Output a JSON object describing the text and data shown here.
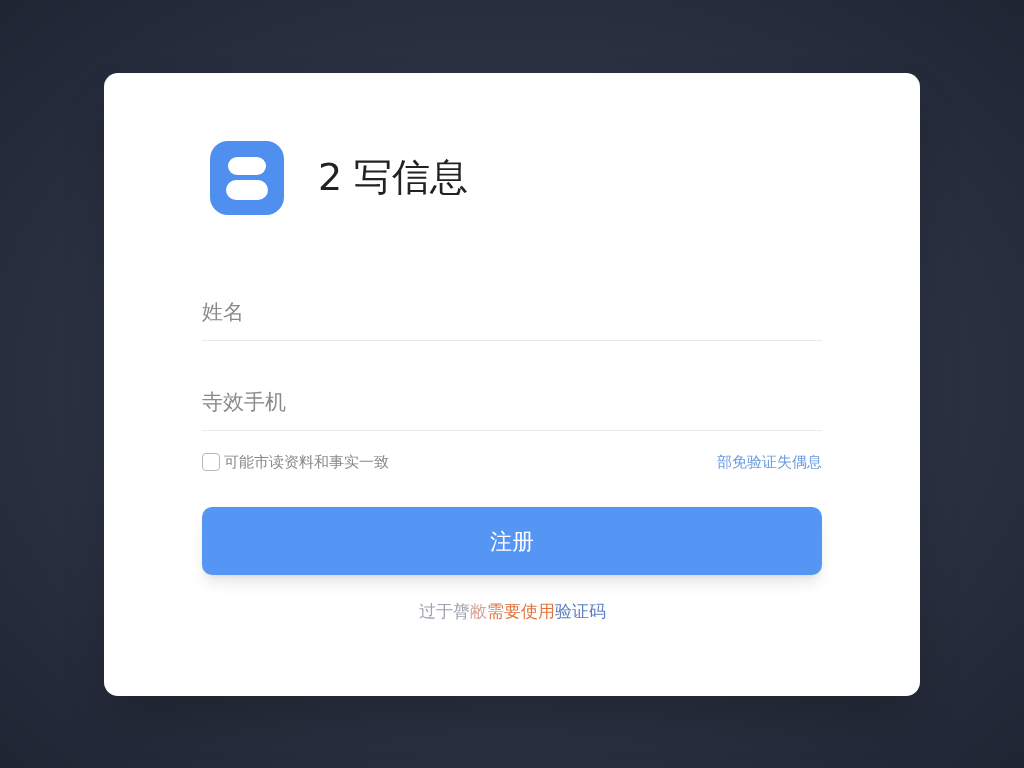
{
  "header": {
    "title": "2 写信息"
  },
  "fields": [
    {
      "placeholder": "姓名"
    },
    {
      "placeholder": "寺效手机"
    }
  ],
  "agreement": {
    "label": "可能市读资料和事实一致",
    "checked": false
  },
  "link": "部免验证失偶息",
  "submit": "注册",
  "footer": [
    {
      "text": "过于膂",
      "color": "#9ca3af"
    },
    {
      "text": "敝",
      "color": "#d6a89a"
    },
    {
      "text": "需要使用",
      "color": "#e0763f"
    },
    {
      "text": "验证码",
      "color": "#5b7fc4"
    }
  ]
}
